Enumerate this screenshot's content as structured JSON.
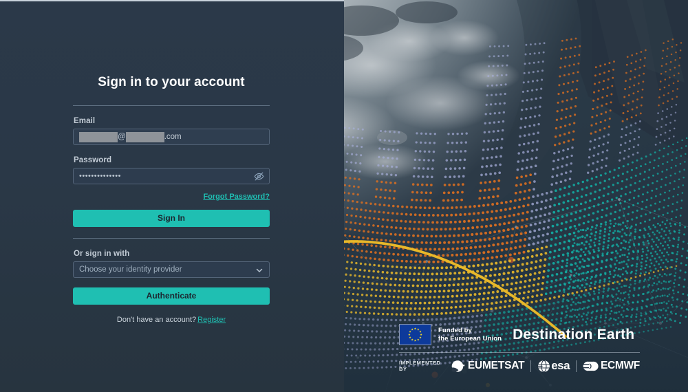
{
  "page": {
    "title": "Sign in to your account",
    "background_color": "#2a3847",
    "accent_color": "#1fbfb2"
  },
  "form": {
    "email": {
      "label": "Email",
      "redacted": true,
      "at_symbol": "@",
      "tld": ".com",
      "value": ""
    },
    "password": {
      "label": "Password",
      "masked_value": "••••••••••••••",
      "toggle_icon": "eye-slash-icon"
    },
    "forgot_password_link": "Forgot Password?",
    "sign_in_button": "Sign In",
    "or_sign_in_with_label": "Or sign in with",
    "identity_provider": {
      "placeholder": "Choose your identity provider",
      "selected": "Choose your identity provider",
      "chevron_icon": "chevron-down-icon"
    },
    "authenticate_button": "Authenticate",
    "register_prompt": "Don't have an account?",
    "register_link": "Register"
  },
  "branding": {
    "eu_funding_line1": "Funded by",
    "eu_funding_line2": "the European Union",
    "eu_flag_icon": "eu-flag-icon",
    "product_name": "Destination Earth",
    "implemented_by_label": "IMPLEMENTED BY",
    "partners": [
      {
        "name": "EUMETSAT",
        "icon": "eumetsat-logo-icon"
      },
      {
        "name": "esa",
        "icon": "esa-logo-icon"
      },
      {
        "name": "ECMWF",
        "icon": "ecmwf-logo-icon"
      }
    ]
  },
  "hero": {
    "description": "Satellite view of Earth with dotted wave data visualisation",
    "palette": {
      "orange": "#e0701f",
      "yellow": "#e8b82a",
      "teal": "#12b3a8",
      "periwinkle": "#a9b0dd",
      "deep_navy": "#253341"
    }
  }
}
